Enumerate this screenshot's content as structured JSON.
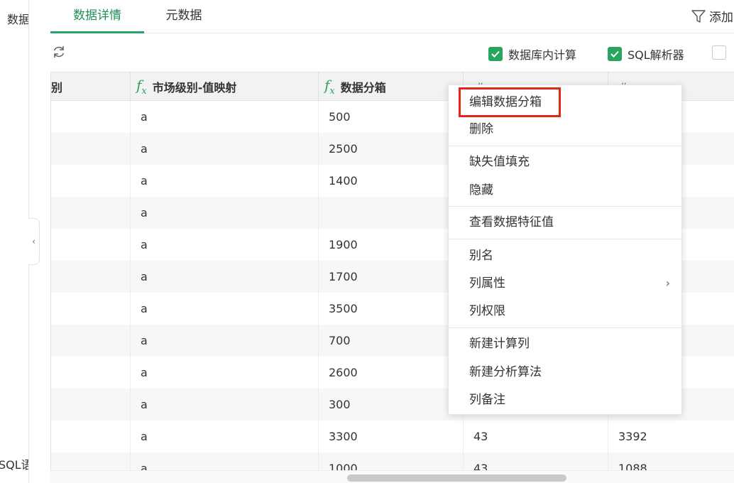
{
  "left_panel": {
    "title": "数据",
    "sql": "SQL语"
  },
  "tabs": [
    {
      "label": "数据详情",
      "active": true
    },
    {
      "label": "元数据",
      "active": false
    }
  ],
  "filter": {
    "label": "添加"
  },
  "toolbar": {
    "checkboxes": [
      {
        "label": "数据库内计算",
        "checked": true
      },
      {
        "label": "SQL解析器",
        "checked": true
      },
      {
        "label": "",
        "checked": false
      }
    ]
  },
  "table": {
    "headers": [
      {
        "label": "别",
        "type": ""
      },
      {
        "label": "市场级别-值映射",
        "type": "fx"
      },
      {
        "label": "数据分箱",
        "type": "fx"
      },
      {
        "label": "",
        "type": "#"
      },
      {
        "label": "",
        "type": "#"
      }
    ],
    "rows": [
      [
        "",
        "a",
        "500",
        "",
        ""
      ],
      [
        "",
        "a",
        "2500",
        "",
        ""
      ],
      [
        "",
        "a",
        "1400",
        "",
        ""
      ],
      [
        "",
        "a",
        "",
        "",
        ""
      ],
      [
        "",
        "a",
        "1900",
        "",
        ""
      ],
      [
        "",
        "a",
        "1700",
        "",
        ""
      ],
      [
        "",
        "a",
        "3500",
        "",
        ""
      ],
      [
        "",
        "a",
        "700",
        "",
        ""
      ],
      [
        "",
        "a",
        "2600",
        "",
        ""
      ],
      [
        "",
        "a",
        "300",
        "",
        ""
      ],
      [
        "",
        "a",
        "3300",
        "43",
        "3392"
      ],
      [
        "",
        "a",
        "1000",
        "43",
        "1088"
      ]
    ]
  },
  "context_menu": {
    "items": [
      {
        "label": "编辑数据分箱",
        "highlighted": true
      },
      {
        "label": "删除"
      },
      {
        "label": "缺失值填充"
      },
      {
        "label": "隐藏"
      },
      {
        "label": "查看数据特征值"
      },
      {
        "label": "别名"
      },
      {
        "label": "列属性",
        "submenu": true
      },
      {
        "label": "列权限"
      },
      {
        "label": "新建计算列"
      },
      {
        "label": "新建分析算法"
      },
      {
        "label": "列备注"
      }
    ]
  },
  "colors": {
    "accent": "#2aa55f",
    "highlight": "#e8231b"
  }
}
